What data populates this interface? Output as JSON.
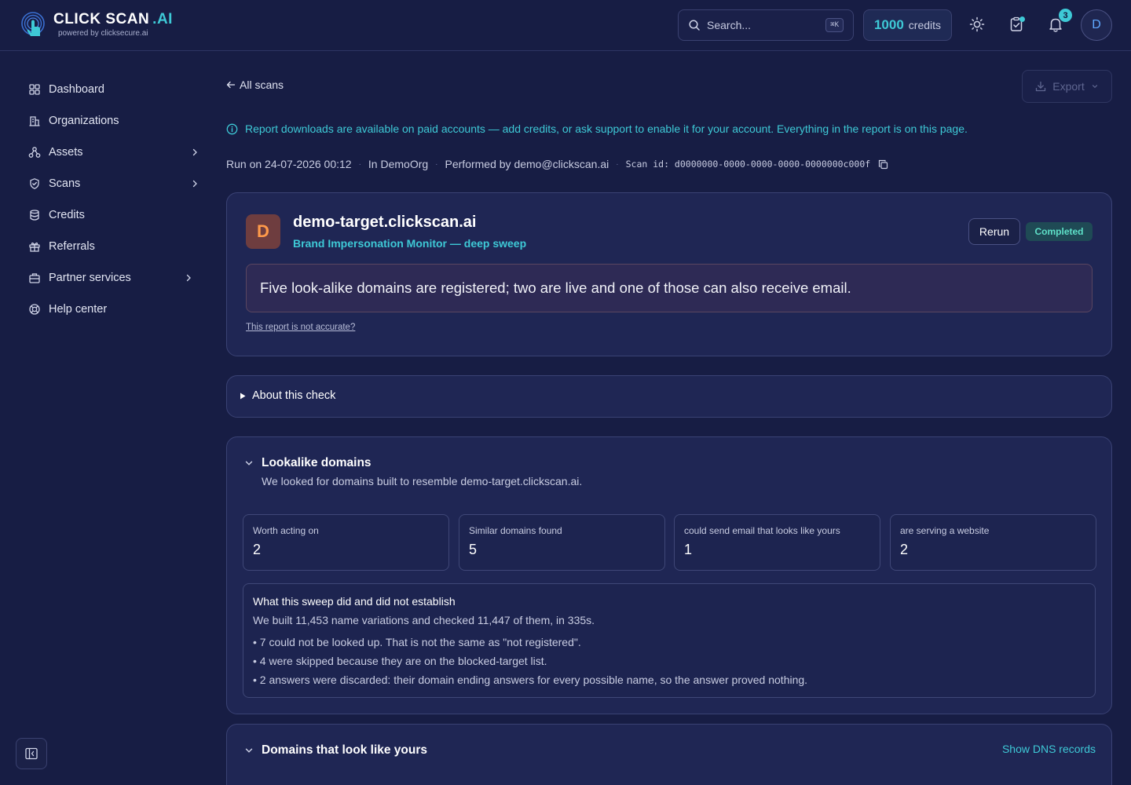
{
  "brand": {
    "name": "CLICK SCAN",
    "suffix": ".AI",
    "powered_by": "powered by clicksecure.ai"
  },
  "topbar": {
    "search_placeholder": "Search...",
    "search_shortcut": "⌘K",
    "credits_count": "1000",
    "credits_label": "credits",
    "notification_count": "3",
    "avatar_initial": "D"
  },
  "sidebar": {
    "items": [
      {
        "label": "Dashboard",
        "icon": "grid-icon",
        "has_chevron": false
      },
      {
        "label": "Organizations",
        "icon": "building-icon",
        "has_chevron": false
      },
      {
        "label": "Assets",
        "icon": "assets-icon",
        "has_chevron": true
      },
      {
        "label": "Scans",
        "icon": "shield-icon",
        "has_chevron": true
      },
      {
        "label": "Credits",
        "icon": "database-icon",
        "has_chevron": false
      },
      {
        "label": "Referrals",
        "icon": "gift-icon",
        "has_chevron": false
      },
      {
        "label": "Partner services",
        "icon": "briefcase-icon",
        "has_chevron": true
      },
      {
        "label": "Help center",
        "icon": "lifebuoy-icon",
        "has_chevron": false
      }
    ]
  },
  "page": {
    "back_label": "All scans",
    "export_label": "Export",
    "info_banner": "Report downloads are available on paid accounts — add credits, or ask support to enable it for your account. Everything in the report is on this page.",
    "meta": {
      "run_on": "Run on 24-07-2026 00:12",
      "org": "In DemoOrg",
      "performed_by": "Performed by demo@clickscan.ai",
      "scan_id": "Scan id: d0000000-0000-0000-0000-0000000c000f"
    }
  },
  "scan_header": {
    "badge_letter": "D",
    "target": "demo-target.clickscan.ai",
    "check_name": "Brand Impersonation Monitor — deep sweep",
    "rerun_label": "Rerun",
    "status": "Completed",
    "summary": "Five look-alike domains are registered; two are live and one of those can also receive email.",
    "accuracy_link": "This report is not accurate?"
  },
  "about": {
    "label": "About this check"
  },
  "lookalike": {
    "title": "Lookalike domains",
    "description": "We looked for domains built to resemble demo-target.clickscan.ai.",
    "stats": [
      {
        "label": "Worth acting on",
        "value": "2"
      },
      {
        "label": "Similar domains found",
        "value": "5"
      },
      {
        "label": "could send email that looks like yours",
        "value": "1"
      },
      {
        "label": "are serving a website",
        "value": "2"
      }
    ],
    "establish": {
      "title": "What this sweep did and did not establish",
      "intro": "We built 11,453 name variations and checked 11,447 of them, in 335s.",
      "bullets": [
        "• 7 could not be looked up. That is not the same as \"not registered\".",
        "• 4 were skipped because they are on the blocked-target list.",
        "• 2 answers were discarded: their domain ending answers for every possible name, so the answer proved nothing."
      ]
    }
  },
  "domains_section": {
    "title": "Domains that look like yours",
    "dns_link": "Show DNS records"
  },
  "colors": {
    "background": "#171d44",
    "card": "#1f2654",
    "accent": "#3ec9d6",
    "status_completed": "#5ee0c8",
    "badge_bg": "#6e3d3f",
    "badge_fg": "#ff9a4a"
  }
}
